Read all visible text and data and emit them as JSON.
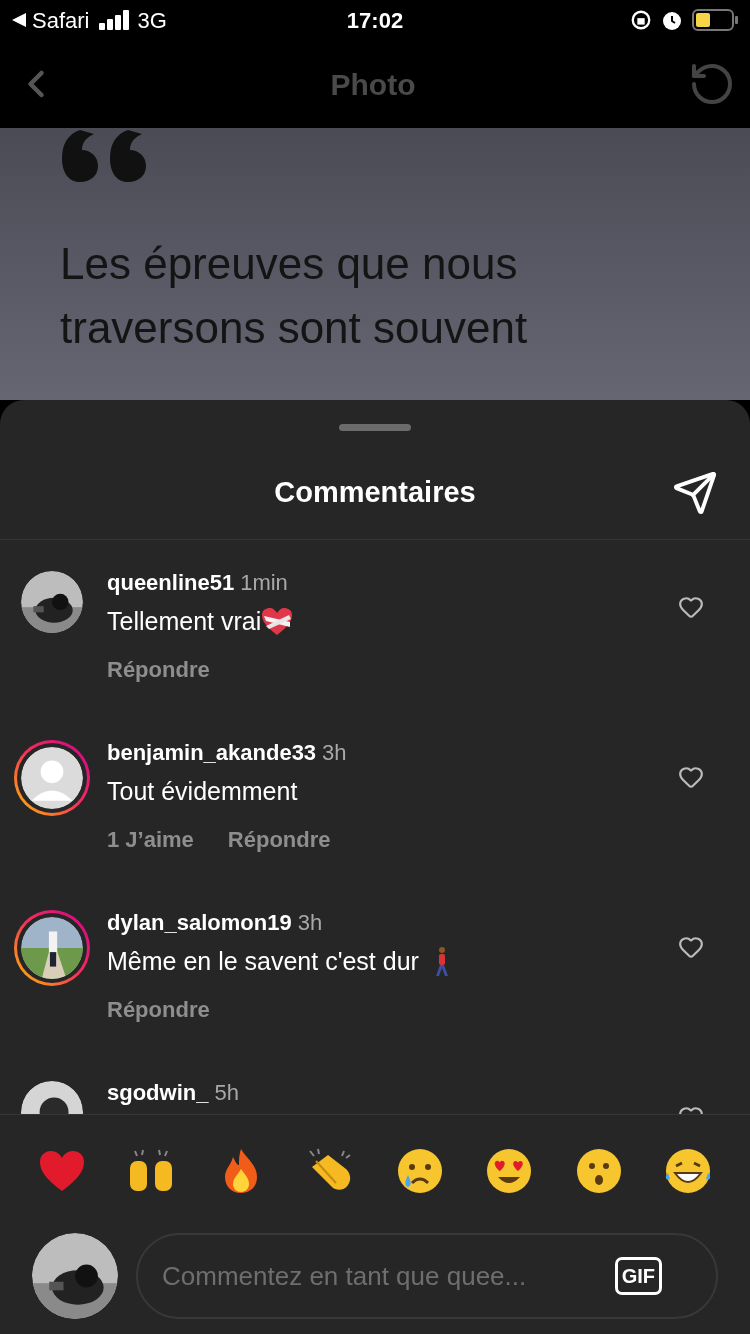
{
  "status_bar": {
    "back_app": "Safari",
    "network": "3G",
    "time": "17:02"
  },
  "nav": {
    "title": "Photo"
  },
  "post": {
    "quote_lines": [
      "Les épreuves que nous",
      "traversons sont souvent"
    ]
  },
  "sheet": {
    "title": "Commentaires",
    "comments": [
      {
        "username": "queenline51",
        "time": "1min",
        "text": "Tellement vrai",
        "emoji": {
          "kind": "mending-heart"
        },
        "avatar": {
          "kind": "dark"
        },
        "story_ring": false,
        "actions": [
          "Répondre"
        ]
      },
      {
        "username": "benjamin_akande33",
        "time": "3h",
        "text": "Tout évidemment",
        "avatar": {
          "kind": "default"
        },
        "story_ring": true,
        "actions": [
          "1 J’aime",
          "Répondre"
        ]
      },
      {
        "username": "dylan_salomon19",
        "time": "3h",
        "text": "Même en le savent c'est dur",
        "emoji": {
          "kind": "walking-person"
        },
        "avatar": {
          "kind": "walkway"
        },
        "story_ring": true,
        "actions": [
          "Répondre"
        ]
      },
      {
        "username": "sgodwin_",
        "time": "5h",
        "avatar": {
          "kind": "portrait"
        },
        "story_ring": false
      }
    ]
  },
  "reactions": [
    {
      "kind": "heart"
    },
    {
      "kind": "raised-hands"
    },
    {
      "kind": "fire"
    },
    {
      "kind": "clap"
    },
    {
      "kind": "crying"
    },
    {
      "kind": "heart-eyes"
    },
    {
      "kind": "surprised"
    },
    {
      "kind": "laughing"
    }
  ],
  "composer": {
    "placeholder": "Commentez en tant que quee...",
    "gif": "GIF"
  }
}
